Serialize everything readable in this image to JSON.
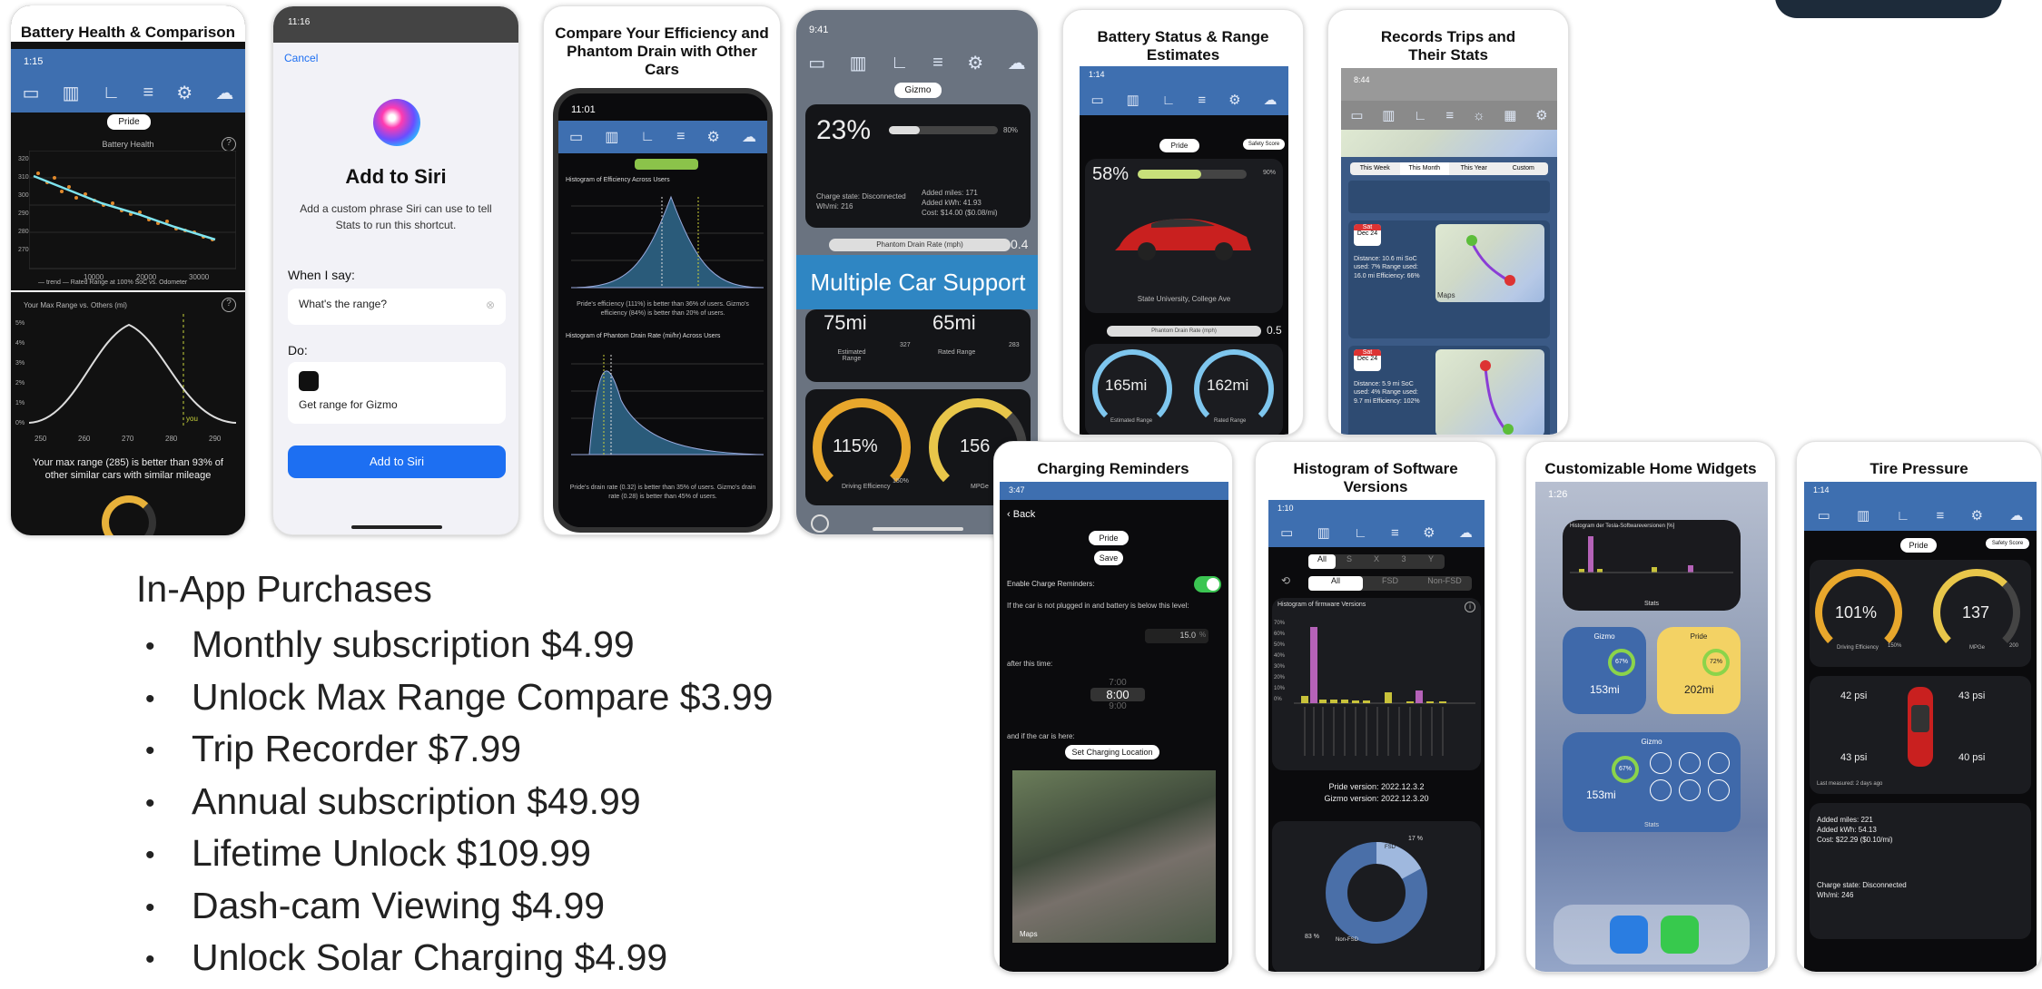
{
  "iap": {
    "heading": "In-App Purchases",
    "items": [
      {
        "bullet": "•",
        "label": "Monthly subscription $4.99"
      },
      {
        "bullet": "•",
        "label": "Unlock Max Range Compare $3.99"
      },
      {
        "bullet": "•",
        "label": "Trip Recorder $7.99"
      },
      {
        "bullet": "•",
        "label": "Annual subscription $49.99"
      },
      {
        "bullet": "•",
        "label": "Lifetime Unlock $109.99"
      },
      {
        "bullet": "•",
        "label": "Dash-cam Viewing $4.99"
      },
      {
        "bullet": "•",
        "label": "Unlock Solar Charging $4.99"
      }
    ]
  },
  "cards": {
    "battery_health": {
      "caption": "Battery Health & Comparison",
      "time": "1:15",
      "pill": "Pride",
      "chart1_title": "Battery Health",
      "chart2_title": "Your Max Range vs. Others (mi)",
      "footer": "Your max range (285) is better than 93% of other similar cars with similar mileage",
      "x_ticks": [
        "10000",
        "20000",
        "30000"
      ],
      "y_ticks": [
        "320",
        "310",
        "300",
        "290",
        "280",
        "270"
      ],
      "x2_ticks": [
        "250",
        "260",
        "270",
        "280",
        "290"
      ],
      "y2_ticks": [
        "5%",
        "4%",
        "3%",
        "2%",
        "1%",
        "0%"
      ],
      "legend": "— trend  — Rated Range at 100% SoC vs. Odometer",
      "you": "you"
    },
    "siri": {
      "time": "11:16",
      "cancel": "Cancel",
      "title": "Add to Siri",
      "desc": "Add a custom phrase Siri can use to tell Stats to run this shortcut.",
      "when_label": "When I say:",
      "phrase": "What's the range?",
      "do_label": "Do:",
      "action": "Get range for Gizmo",
      "button": "Add to Siri"
    },
    "efficiency": {
      "caption": "Compare Your Efficiency and Phantom Drain with Other Cars",
      "time": "11:01",
      "hist1_title": "Histogram of Efficiency Across Users",
      "hist1_note": "Pride's efficiency (111%) is better than 36% of users. Gizmo's efficiency (84%) is better than 20% of users.",
      "hist2_title": "Histogram of Phantom Drain Rate (mi/hr) Across Users",
      "hist2_note": "Pride's drain rate (0.32) is better than 35% of users. Gizmo's drain rate (0.28) is better than 45% of users."
    },
    "multicar": {
      "time": "9:41",
      "pill": "Gizmo",
      "soc": "23%",
      "soc_limit": "80%",
      "charge_state": "Charge state: Disconnected",
      "whmi": "Wh/mi: 216",
      "added_miles": "Added miles: 171",
      "added_kwh": "Added kWh: 41.93",
      "cost": "Cost: $14.00 ($0.08/mi)",
      "drain_label": "Phantom Drain Rate (mph)",
      "drain_val": "0.4",
      "banner": "Multiple Car Support",
      "est_range": "75mi",
      "est_label": "Estimated Range",
      "rated_range": "65mi",
      "rated_label": "Rated Range",
      "est_max": "327",
      "rated_max": "283",
      "eff": "115%",
      "eff_label": "Driving Efficiency",
      "eff_max": "150%",
      "mpge": "156",
      "mpge_label": "MPGe"
    },
    "battery_status": {
      "caption": "Battery Status & Range Estimates",
      "time": "1:14",
      "pill": "Pride",
      "pill2": "Safety Score",
      "soc": "58%",
      "soc_limit": "90%",
      "location": "State University, College Ave",
      "drain_label": "Phantom Drain Rate (mph)",
      "drain_val": "0.5",
      "est_range": "165mi",
      "est_label": "Estimated Range",
      "est_max": "285",
      "rated_range": "162mi",
      "rated_label": "Rated Range",
      "rated_max": "285"
    },
    "trips": {
      "caption": "Records Trips and Their Stats",
      "time": "8:44",
      "tabs": [
        "This Week",
        "This Month",
        "This Year",
        "Custom"
      ],
      "trip1_day": "Sat",
      "trip1_date": "Dec 24",
      "trip1_stats": "Distance: 10.6 mi  SoC used: 7%  Range used: 16.0 mi  Efficiency: 66%",
      "trip2_day": "Sat",
      "trip2_date": "Dec 24",
      "trip2_stats": "Distance: 5.9 mi  SoC used: 4%  Range used: 9.7 mi  Efficiency: 102%",
      "maps": "Maps"
    },
    "charging": {
      "caption": "Charging Reminders",
      "time": "3:47",
      "back": "Back",
      "pill": "Pride",
      "save": "Save",
      "enable": "Enable Charge Reminders:",
      "threshold_text": "If the car is not plugged in and battery is below this level:",
      "threshold": "15.0",
      "pct": "%",
      "time_text": "after this time:",
      "t_prev": "7:00",
      "t_sel": "8:00",
      "t_next": "9:00",
      "loc_text": "and if the car is here:",
      "loc_button": "Set Charging Location",
      "maps": "Maps"
    },
    "software": {
      "caption": "Histogram of Software Versions",
      "time": "1:10",
      "seg1": [
        "All",
        "S",
        "X",
        "3",
        "Y"
      ],
      "seg2": [
        "All",
        "FSD",
        "Non-FSD"
      ],
      "chart_title": "Histogram of firmware Versions",
      "y_ticks": [
        "70%",
        "60%",
        "50%",
        "40%",
        "30%",
        "20%",
        "10%",
        "0%"
      ],
      "pride_version": "Pride version: 2022.12.3.2",
      "gizmo_version": "Gizmo version: 2022.12.3.20",
      "donut_a": "17 %",
      "donut_b": "83 %",
      "donut_fsd": "FSD",
      "donut_nonfsd": "Non-FSD"
    },
    "widgets": {
      "caption": "Customizable Home Widgets",
      "time": "1:26",
      "w1_title": "Histogram der Tesla-Softwareversionen [%]",
      "w1_label": "Stats",
      "gizmo": "Gizmo",
      "pride": "Pride",
      "gizmo_range": "153mi",
      "pride_range": "202mi",
      "gizmo_soc": "67%",
      "pride_soc": "72%",
      "stats": "Stats"
    },
    "tires": {
      "caption": "Tire Pressure",
      "time": "1:14",
      "pill": "Pride",
      "pill2": "Safety Score",
      "eff": "101%",
      "eff_label": "Driving Efficiency",
      "eff_max": "150%",
      "mpge": "137",
      "mpge_label": "MPGe",
      "mpge_max": "200",
      "fl": "42 psi",
      "fr": "43 psi",
      "rl": "43 psi",
      "rr": "40 psi",
      "measured": "Last measured: 2 days ago",
      "added_miles": "Added miles: 221",
      "added_kwh": "Added kWh: 54.13",
      "cost": "Cost: $22.29 ($0.10/mi)",
      "charge_state": "Charge state: Disconnected",
      "whmi": "Wh/mi: 246"
    }
  }
}
